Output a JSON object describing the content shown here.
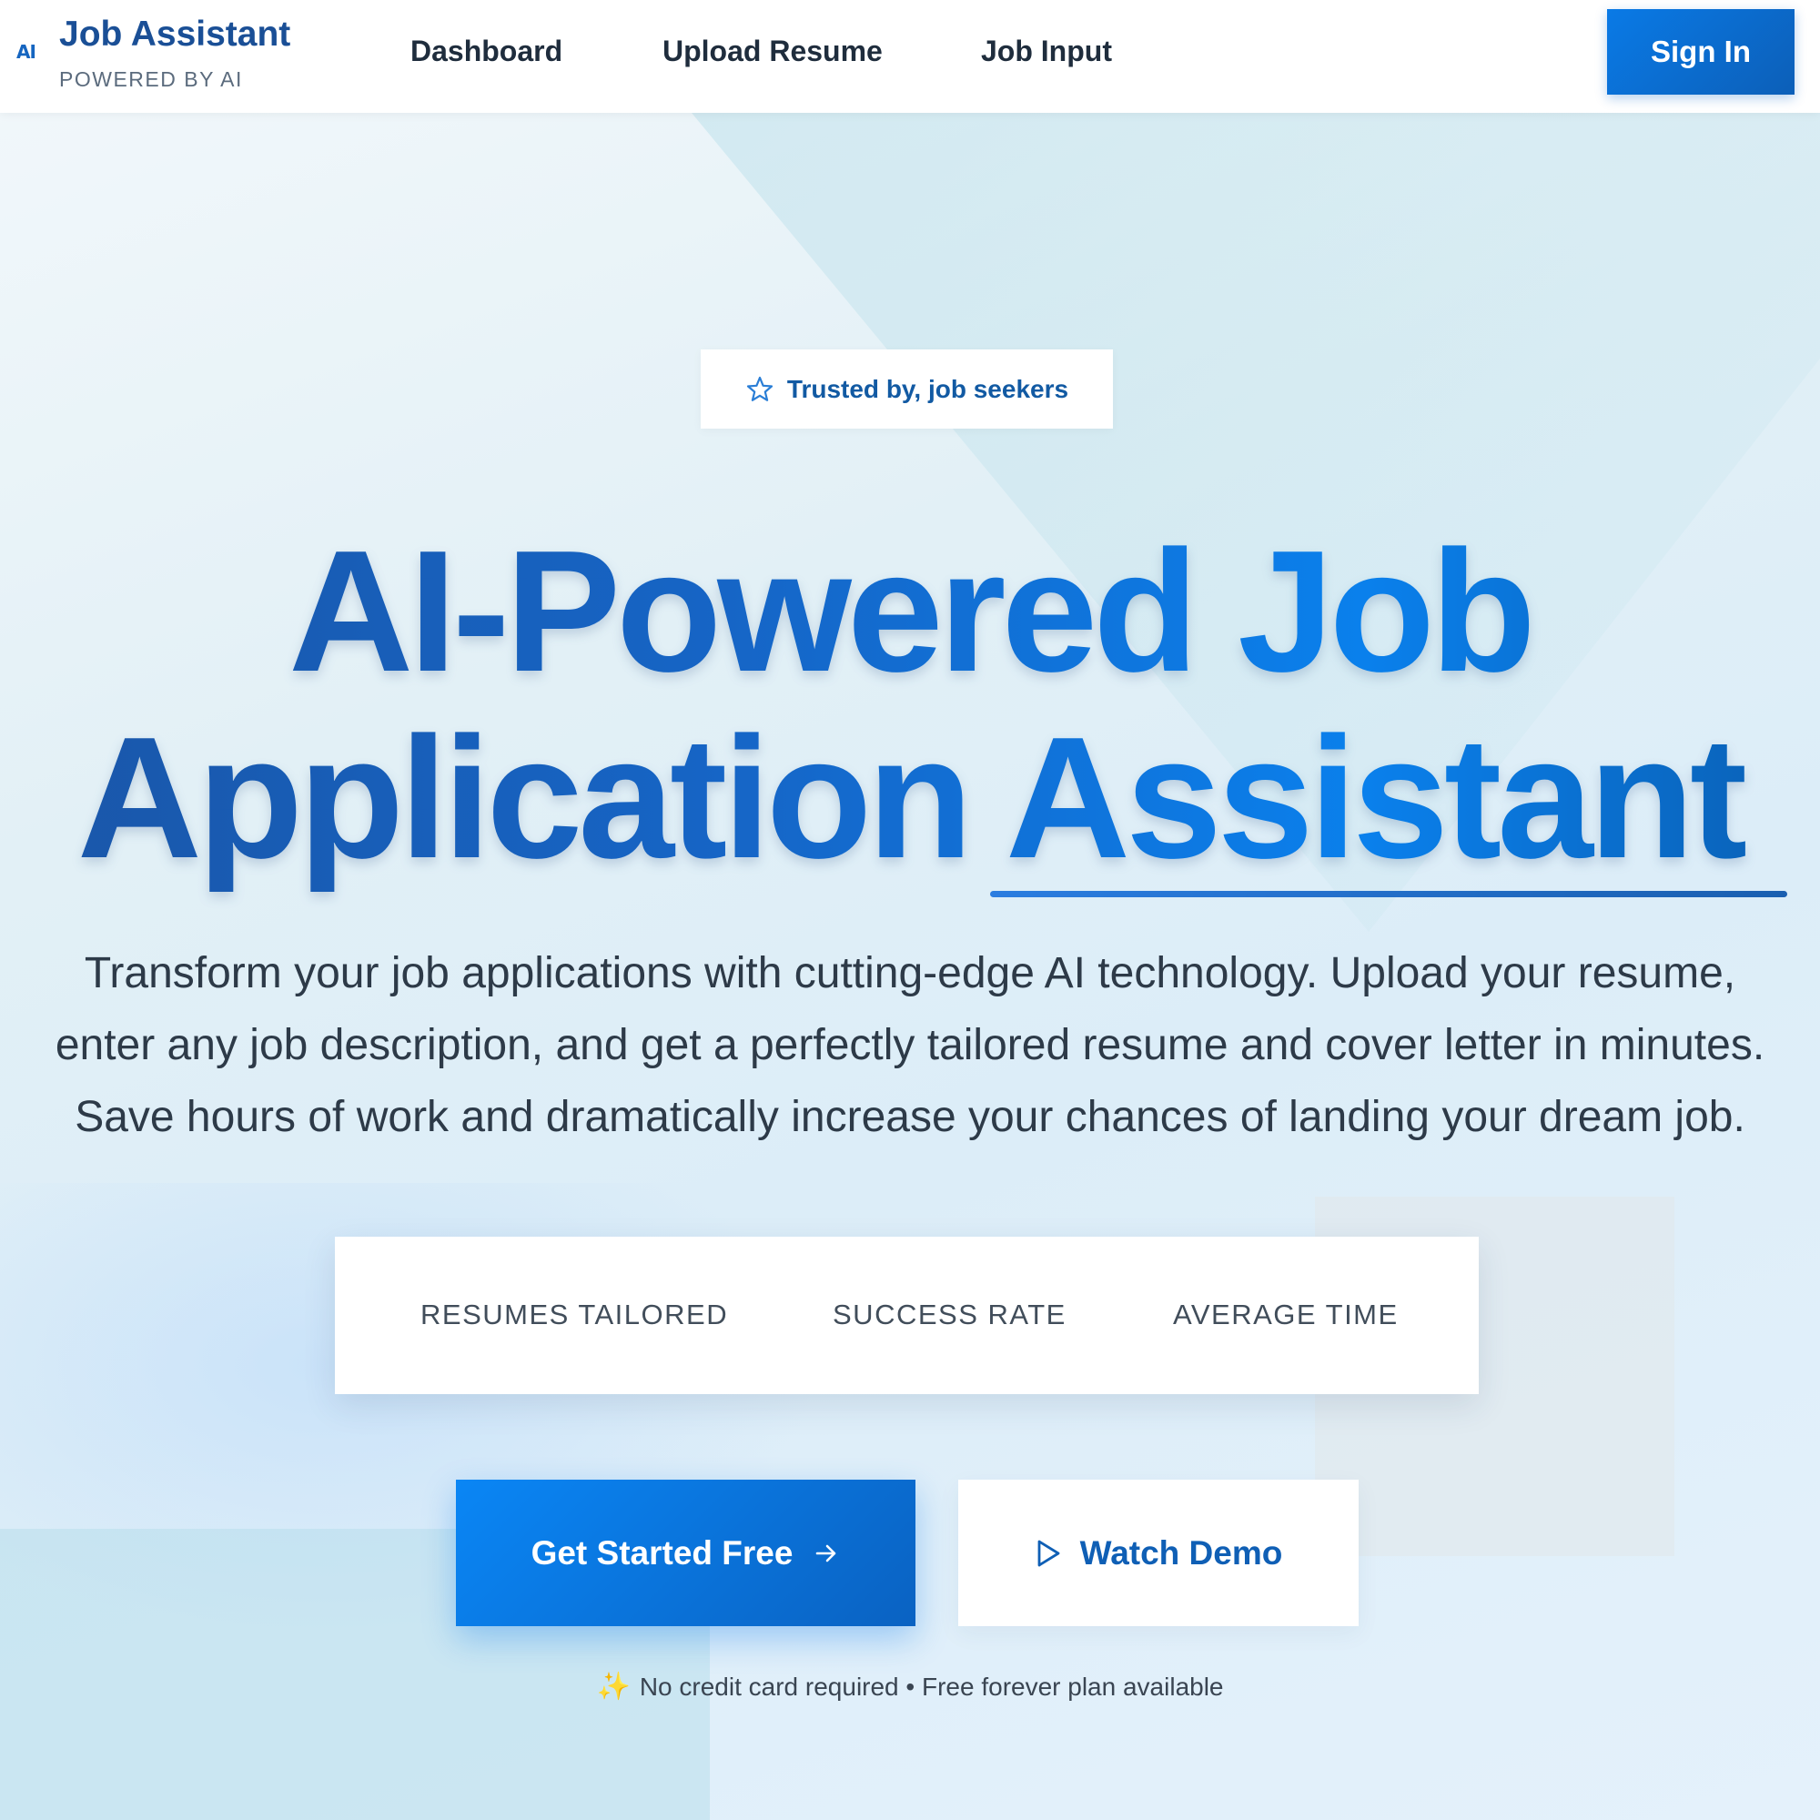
{
  "header": {
    "logo_mark": "AI",
    "brand_title": "Job Assistant",
    "brand_subtitle": "POWERED BY AI",
    "nav": [
      {
        "label": "Dashboard"
      },
      {
        "label": "Upload Resume"
      },
      {
        "label": "Job Input"
      }
    ],
    "signin_label": "Sign In"
  },
  "hero": {
    "badge_icon": "star-outline-icon",
    "badge_text": "Trusted by, job seekers",
    "headline_line1": "AI-Powered Job",
    "headline_line2": "Application Assistant",
    "description_lines": [
      "Transform your job applications with cutting-edge AI technology. Upload your resume,",
      "enter any job description, and get a perfectly tailored resume and cover letter in minutes.",
      "Save hours of work and dramatically increase your chances of landing your dream job."
    ]
  },
  "stats": [
    {
      "label": "RESUMES TAILORED"
    },
    {
      "label": "SUCCESS RATE"
    },
    {
      "label": "AVERAGE TIME"
    }
  ],
  "cta": {
    "primary_label": "Get Started Free",
    "primary_icon": "arrow-right-icon",
    "secondary_label": "Watch Demo",
    "secondary_icon": "play-icon"
  },
  "footnote": {
    "icon": "sparkles-icon",
    "text": "No credit card required • Free forever plan available"
  },
  "colors": {
    "brand": "#1565c0",
    "accent": "#0a80ec",
    "text_dark": "#1f2d3d"
  }
}
